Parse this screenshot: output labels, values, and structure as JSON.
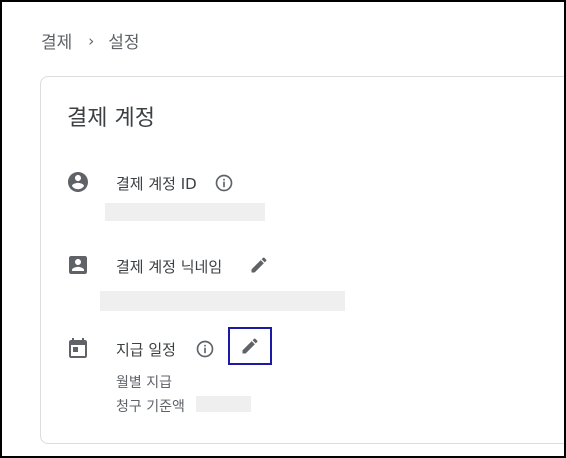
{
  "breadcrumb": {
    "parent": "결제",
    "separator": "›",
    "current": "설정"
  },
  "card": {
    "title": "결제 계정"
  },
  "rows": {
    "account_id": {
      "label": "결제 계정 ID",
      "icon": "account-circle-icon"
    },
    "nickname": {
      "label": "결제 계정 닉네임",
      "icon": "contact-card-icon"
    },
    "schedule": {
      "label": "지급 일정",
      "icon": "calendar-icon",
      "frequency": "월별 지급",
      "threshold_label": "청구 기준액"
    }
  },
  "colors": {
    "icon": "#5f6368",
    "highlight": "#1a1aa6"
  }
}
